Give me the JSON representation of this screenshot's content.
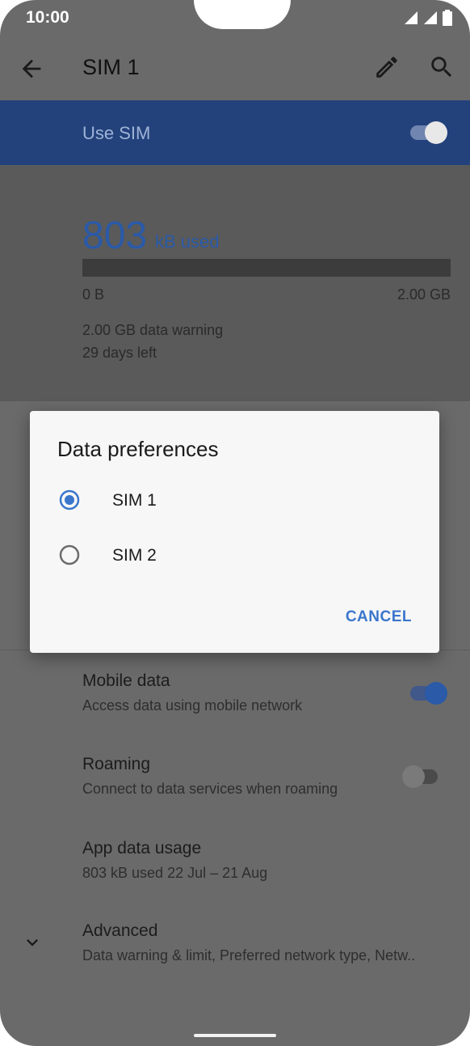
{
  "status_bar": {
    "time": "10:00"
  },
  "app_bar": {
    "title": "SIM 1"
  },
  "use_sim": {
    "label": "Use SIM",
    "enabled": true
  },
  "usage": {
    "amount": "803",
    "unit": "kB used",
    "range_min": "0 B",
    "range_max": "2.00 GB",
    "fill_fraction": 0.0,
    "warning": "2.00 GB data warning",
    "days_left": "29 days left"
  },
  "dialog": {
    "title": "Data preferences",
    "options": [
      {
        "label": "SIM 1",
        "selected": true
      },
      {
        "label": "SIM 2",
        "selected": false
      }
    ],
    "cancel_label": "CANCEL"
  },
  "settings": [
    {
      "title": "Mobile data",
      "subtitle": "Access data using mobile network",
      "toggle": true
    },
    {
      "title": "Roaming",
      "subtitle": "Connect to data services when roaming",
      "toggle": false
    },
    {
      "title": "App data usage",
      "subtitle": "803 kB used 22 Jul – 21 Aug"
    },
    {
      "title": "Advanced",
      "subtitle": "Data warning & limit, Preferred network type, Netw.."
    }
  ],
  "colors": {
    "accent": "#2a5aa8",
    "dialog_accent": "#3a76cc",
    "scrim": "#6a6a6a"
  }
}
